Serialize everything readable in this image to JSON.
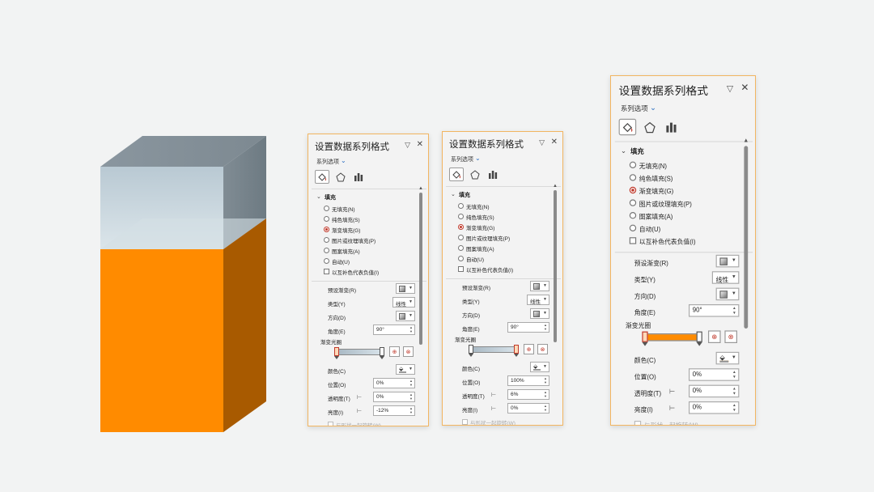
{
  "cube": {
    "liquid_color": "#ff8b00",
    "glass_color": "#c7d6df",
    "top_color": "#8c98a1"
  },
  "accent": "#f2b561",
  "panels": [
    {
      "title": "设置数据系列格式",
      "series_options": "系列选项",
      "section_fill": "填充",
      "fill_options": [
        "无填充(N)",
        "纯色填充(S)",
        "渐变填充(G)",
        "图片或纹理填充(P)",
        "图案填充(A)",
        "自动(U)"
      ],
      "selected_fill": 2,
      "invert_label": "以互补色代表负值(I)",
      "preset_label": "预设渐变(R)",
      "type_label": "类型(Y)",
      "type_value": "线性",
      "direction_label": "方向(D)",
      "angle_label": "角度(E)",
      "angle_value": "90°",
      "stops_label": "渐变光圈",
      "color_label": "颜色(C)",
      "color_line": "#ffffff",
      "position_label": "位置(O)",
      "position_value": "0%",
      "transparency_label": "透明度(T)",
      "transparency_value": "0%",
      "brightness_label": "亮度(I)",
      "brightness_value": "-12%",
      "rotate_label": "与形状一起旋转(W)",
      "bar_gradient": "linear-gradient(to right, #a8b8c3, #d8e3ea)",
      "active_stop": "left"
    },
    {
      "title": "设置数据系列格式",
      "series_options": "系列选项",
      "section_fill": "填充",
      "fill_options": [
        "无填充(N)",
        "纯色填充(S)",
        "渐变填充(G)",
        "图片或纹理填充(P)",
        "图案填充(A)",
        "自动(U)"
      ],
      "selected_fill": 2,
      "invert_label": "以互补色代表负值(I)",
      "preset_label": "预设渐变(R)",
      "type_label": "类型(Y)",
      "type_value": "线性",
      "direction_label": "方向(D)",
      "angle_label": "角度(E)",
      "angle_value": "90°",
      "stops_label": "渐变光圈",
      "color_label": "颜色(C)",
      "color_line": "#ffffff",
      "position_label": "位置(O)",
      "position_value": "100%",
      "transparency_label": "透明度(T)",
      "transparency_value": "6%",
      "brightness_label": "亮度(I)",
      "brightness_value": "0%",
      "rotate_label": "与形状一起旋转(W)",
      "bar_gradient": "linear-gradient(to right, #a8b8c3, #d8e3ea)",
      "active_stop": "right"
    },
    {
      "title": "设置数据系列格式",
      "series_options": "系列选项",
      "section_fill": "填充",
      "fill_options": [
        "无填充(N)",
        "纯色填充(S)",
        "渐变填充(G)",
        "图片或纹理填充(P)",
        "图案填充(A)",
        "自动(U)"
      ],
      "selected_fill": 2,
      "invert_label": "以互补色代表负值(I)",
      "preset_label": "预设渐变(R)",
      "type_label": "类型(Y)",
      "type_value": "线性",
      "direction_label": "方向(D)",
      "angle_label": "角度(E)",
      "angle_value": "90°",
      "stops_label": "渐变光圈",
      "color_label": "颜色(C)",
      "color_line": "#ff8b00",
      "position_label": "位置(O)",
      "position_value": "0%",
      "transparency_label": "透明度(T)",
      "transparency_value": "0%",
      "brightness_label": "亮度(I)",
      "brightness_value": "0%",
      "rotate_label": "与形状一起旋转(W)",
      "bar_gradient": "linear-gradient(to right, #ff8b00, #ff8b00)",
      "active_stop": "left"
    }
  ]
}
